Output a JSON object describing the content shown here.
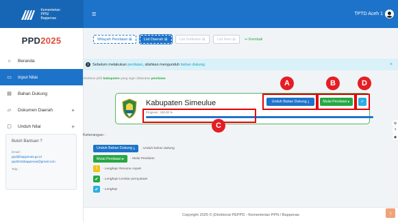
{
  "header": {
    "brand_line1": "Kementerian PPN/",
    "brand_line2": "Bappenas",
    "menu_icon": "hamburger-icon",
    "user_name": "TPTD Aceh 1",
    "user_icon": "user-avatar-icon",
    "colors": {
      "header_bg": "#1d73c9",
      "accent_green": "#28a745",
      "annotation_red": "#e31e24"
    }
  },
  "sidebar": {
    "title_prefix": "PPD",
    "title_year": "2025",
    "items": [
      {
        "label": "Beranda",
        "icon": "home-icon"
      },
      {
        "label": "Input Nilai",
        "icon": "input-icon",
        "active": true
      },
      {
        "label": "Bahan Dukung",
        "icon": "document-icon"
      },
      {
        "label": "Dokumen Daerah",
        "icon": "folder-icon",
        "expand": "+"
      },
      {
        "label": "Unduh Nilai",
        "icon": "monitor-icon",
        "expand": "+"
      }
    ],
    "help": {
      "title": "Butuh Bantuan ?",
      "email_label": "Email :",
      "email1": "ppd@bappenas.go.id",
      "email2": "ppd2015bappenas@gmail.com",
      "phone_label": "Telp :"
    }
  },
  "tabs": [
    {
      "label": "Wilayah Penilaian ⊞",
      "style": "outline"
    },
    {
      "label": "List Daerah ⊞",
      "style": "primary"
    },
    {
      "label": "List Indikator ⊞",
      "style": "disabled"
    },
    {
      "label": "List Item ⊞",
      "style": "disabled"
    },
    {
      "label": "↩ Kembali",
      "style": "link"
    }
  ],
  "alert": {
    "prefix": "Sebelum melakukan ",
    "word1": "penilaian",
    "middle": ", silahkan mengunduh ",
    "word2": "bahan dukung",
    "suffix": "."
  },
  "instruction": {
    "text": "Silahkan pilih ",
    "bold1": "kabupaten",
    "middle": " yang ingin dilakukan ",
    "bold2": "penilaian"
  },
  "card": {
    "name": "Kabupaten Simeulue",
    "progress_label": "Progress : 100.00 %",
    "progress_value": 1.0,
    "download_button": "Unduh Bahan Dukung ⤓",
    "start_button": "Mulai Penilaian ▸",
    "check_button_icon": "check-circle-icon"
  },
  "annotations": {
    "a": "A",
    "b": "B",
    "c": "C",
    "d": "D"
  },
  "legend": {
    "title": "Keterangan :",
    "rows": [
      {
        "badge": "Unduh Bahan Dukung ⤓",
        "text": "- Unduh bahan dukung",
        "color": "#1d73c9"
      },
      {
        "badge": "Mulai Penilaian ▸",
        "text": "- Mulai Penilaian",
        "color": "#28a745"
      },
      {
        "badge": "!",
        "text": "- Lengkapi Resume Aspek",
        "color": "#f0c419"
      },
      {
        "badge": "✔",
        "text": "- Lengkapi Lembar pernyataan",
        "color": "#28a745"
      },
      {
        "badge": "✔",
        "text": "- Lengkap",
        "color": "#2baee0"
      }
    ]
  },
  "footer": {
    "text": "Copyright 2025 © |Direktorat PEPPD - Kementerian PPN / Bappenas"
  },
  "scroll_top_icon": "arrow-up-icon"
}
